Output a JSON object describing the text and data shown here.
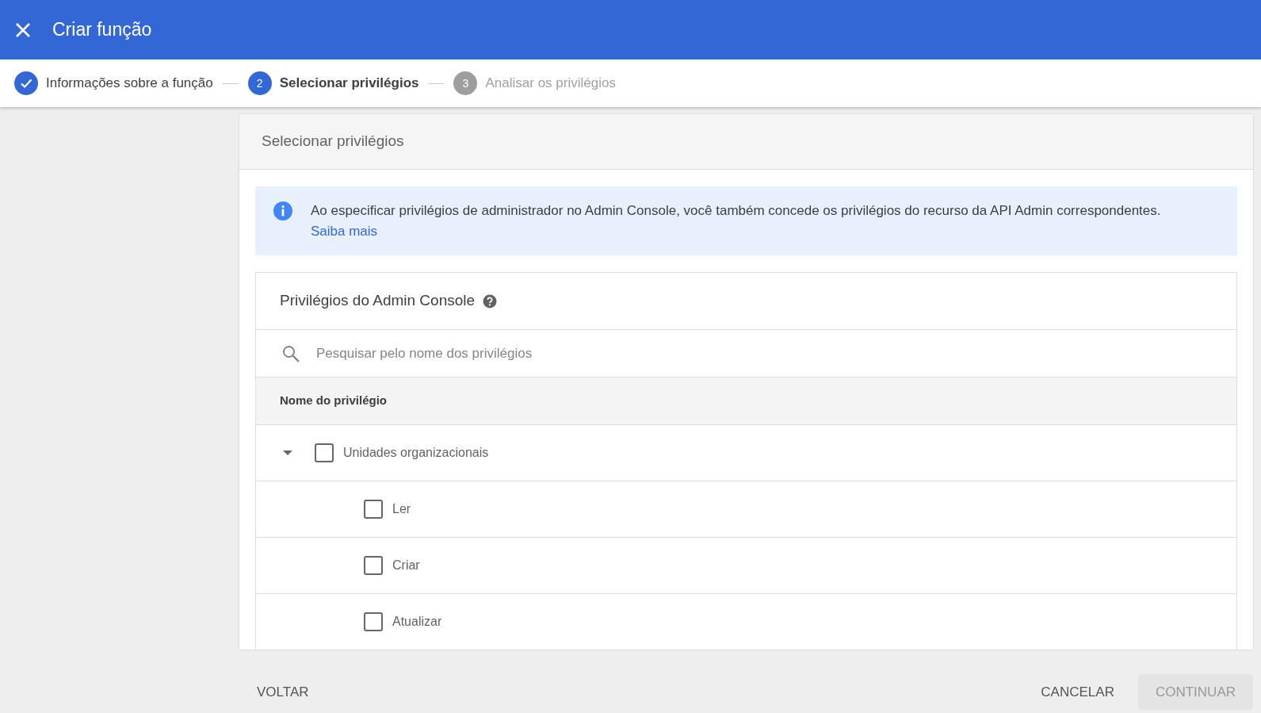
{
  "header": {
    "title": "Criar função"
  },
  "steps": [
    {
      "label": "Informações sobre a função",
      "kind": "done"
    },
    {
      "number": "2",
      "label": "Selecionar privilégios",
      "kind": "current"
    },
    {
      "number": "3",
      "label": "Analisar os privilégios",
      "kind": "pending"
    }
  ],
  "panel": {
    "title": "Selecionar privilégios"
  },
  "info": {
    "text": "Ao especificar privilégios de administrador no Admin Console, você também concede os privilégios do recurso da API Admin correspondentes.",
    "link": "Saiba mais"
  },
  "privileges": {
    "title": "Privilégios do Admin Console",
    "search": {
      "placeholder": "Pesquisar pelo nome dos privilégios"
    },
    "column": "Nome do privilégio",
    "items": [
      {
        "label": "Unidades organizacionais",
        "checked": false,
        "expanded": true,
        "children": [
          {
            "label": "Ler",
            "checked": false
          },
          {
            "label": "Criar",
            "checked": false
          },
          {
            "label": "Atualizar",
            "checked": false
          }
        ]
      }
    ]
  },
  "footer": {
    "back": "VOLTAR",
    "cancel": "CANCELAR",
    "continue": "CONTINUAR",
    "continue_disabled": true
  }
}
